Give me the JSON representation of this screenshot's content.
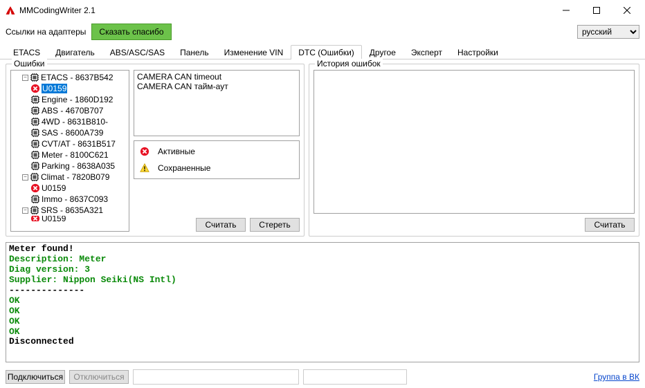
{
  "window": {
    "title": "MMCodingWriter 2.1"
  },
  "toolbar": {
    "adapters_link": "Ссылки на адаптеры",
    "thanks": "Сказать спасибо"
  },
  "language": {
    "selected": "русский"
  },
  "tabs": [
    "ETACS",
    "Двигатель",
    "ABS/ASC/SAS",
    "Панель",
    "Изменение VIN",
    "DTC (Ошибки)",
    "Другое",
    "Эксперт",
    "Настройки"
  ],
  "active_tab": 5,
  "errors": {
    "legend": "Ошибки",
    "tree": [
      {
        "type": "ecu",
        "expand": "-",
        "ind": 0,
        "label": "ETACS - 8637B542"
      },
      {
        "type": "code",
        "ind": 1,
        "label": "U0159",
        "selected": true
      },
      {
        "type": "ecu",
        "ind": 1,
        "label": "Engine - 1860D192"
      },
      {
        "type": "ecu",
        "ind": 1,
        "label": "ABS - 4670B707"
      },
      {
        "type": "ecu",
        "ind": 1,
        "label": "4WD - 8631B810-"
      },
      {
        "type": "ecu",
        "ind": 1,
        "label": "SAS - 8600A739"
      },
      {
        "type": "ecu",
        "ind": 1,
        "label": "CVT/AT - 8631B517"
      },
      {
        "type": "ecu",
        "ind": 1,
        "label": "Meter - 8100C621"
      },
      {
        "type": "ecu",
        "ind": 1,
        "label": "Parking - 8638A035"
      },
      {
        "type": "ecu",
        "expand": "-",
        "ind": 0,
        "label": "Climat - 7820B079"
      },
      {
        "type": "code",
        "ind": 1,
        "label": "U0159"
      },
      {
        "type": "ecu",
        "ind": 1,
        "label": "Immo - 8637C093"
      },
      {
        "type": "ecu",
        "expand": "-",
        "ind": 0,
        "label": "SRS - 8635A321"
      },
      {
        "type": "code",
        "ind": 1,
        "label": "U0159",
        "clip": true
      }
    ],
    "detail": [
      "CAMERA CAN timeout",
      "CAMERA CAN тайм-аут"
    ],
    "legend_active": "Активные",
    "legend_stored": "Сохраненные",
    "read_btn": "Считать",
    "erase_btn": "Стереть"
  },
  "history": {
    "legend": "История ошибок",
    "read_btn": "Считать"
  },
  "console": [
    {
      "cls": "black",
      "text": "Meter found!"
    },
    {
      "cls": "green",
      "text": "Description:  Meter"
    },
    {
      "cls": "green",
      "text": "Diag version: 3"
    },
    {
      "cls": "green",
      "text": "Supplier:     Nippon Seiki(NS Intl)"
    },
    {
      "cls": "black",
      "text": "--------------"
    },
    {
      "cls": "green",
      "text": "OK"
    },
    {
      "cls": "green",
      "text": "OK"
    },
    {
      "cls": "green",
      "text": "OK"
    },
    {
      "cls": "green",
      "text": "OK"
    },
    {
      "cls": "black",
      "text": "Disconnected"
    }
  ],
  "footer": {
    "connect": "Подключиться",
    "disconnect": "Отключиться",
    "vk_link": "Группа в ВК"
  }
}
